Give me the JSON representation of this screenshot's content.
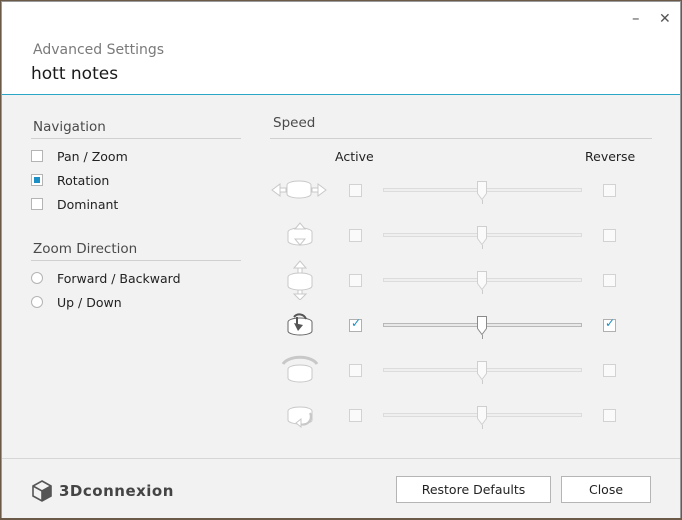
{
  "window": {
    "subtitle": "Advanced Settings",
    "title": "hott notes",
    "minimize_glyph": "–",
    "close_glyph": "✕",
    "accent": "#2aa6c6"
  },
  "navigation": {
    "heading": "Navigation",
    "options": [
      {
        "label": "Pan / Zoom",
        "checked": false
      },
      {
        "label": "Rotation",
        "checked": true
      },
      {
        "label": "Dominant",
        "checked": false
      }
    ]
  },
  "zoom_direction": {
    "heading": "Zoom Direction",
    "options": [
      {
        "label": "Forward / Backward",
        "selected": false
      },
      {
        "label": "Up / Down",
        "selected": false
      }
    ]
  },
  "speed": {
    "heading": "Speed",
    "active_label": "Active",
    "reverse_label": "Reverse",
    "axes": [
      {
        "icon": "pan-left-right-icon",
        "active": false,
        "reverse": false,
        "level": 0.5
      },
      {
        "icon": "zoom-icon",
        "active": false,
        "reverse": false,
        "level": 0.5
      },
      {
        "icon": "pan-up-down-icon",
        "active": false,
        "reverse": false,
        "level": 0.5
      },
      {
        "icon": "tilt-icon",
        "active": true,
        "reverse": true,
        "level": 0.5
      },
      {
        "icon": "spin-icon",
        "active": false,
        "reverse": false,
        "level": 0.5
      },
      {
        "icon": "roll-icon",
        "active": false,
        "reverse": false,
        "level": 0.5
      }
    ]
  },
  "footer": {
    "brand": "3Dconnexion",
    "restore_label": "Restore Defaults",
    "close_label": "Close"
  }
}
